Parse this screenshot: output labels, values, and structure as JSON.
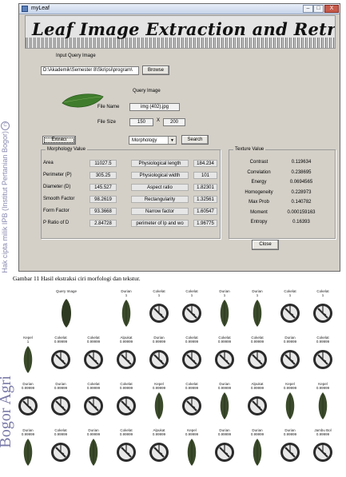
{
  "watermark": {
    "copyright_text": "Hak cipta milik IPB (Institut Pertanian Bogor)",
    "brand_text": "Bogor Agri",
    "copyright_symbol": "C"
  },
  "window": {
    "title": "myLeaf",
    "controls": {
      "minimize": "–",
      "maximize": "□",
      "close": "X"
    }
  },
  "app": {
    "banner_title": "Leaf Image Extraction and Retrieval",
    "input_label": "Input Query Image",
    "path_value": "D:\\Akademik\\Semester 8\\Skripsi\\program\\",
    "browse_label": "Browse",
    "query_image_label": "Query Image",
    "file_name_label": "File Name",
    "file_name_value": "img (402).jpg",
    "file_size_label": "File Size",
    "file_size_w": "150",
    "file_size_x": "X",
    "file_size_h": "200",
    "extract_label": "Extract",
    "method_value": "Morphology",
    "search_label": "Search",
    "close_label": "Close"
  },
  "morphology": {
    "title": "Morphology Value",
    "left": [
      {
        "label": "Area",
        "value": "11027.5"
      },
      {
        "label": "Perimeter (P)",
        "value": "305.25"
      },
      {
        "label": "Diameter (D)",
        "value": "145.527"
      },
      {
        "label": "Smooth Factor",
        "value": "98.2619"
      },
      {
        "label": "Form Factor",
        "value": "93.3668"
      },
      {
        "label": "P Ratio of D",
        "value": "2.84728"
      }
    ],
    "right": [
      {
        "label": "Physiological length",
        "value": "184.234"
      },
      {
        "label": "Physiological width",
        "value": "101"
      },
      {
        "label": "Aspect ratio",
        "value": "1.82301"
      },
      {
        "label": "Rectangularity",
        "value": "1.32561"
      },
      {
        "label": "Narrow factor",
        "value": "1.60547"
      },
      {
        "label": "perimeter of lp and wo",
        "value": "1.96775"
      }
    ]
  },
  "texture": {
    "title": "Texture Value",
    "rows": [
      {
        "label": "Contrast",
        "value": "0.119634"
      },
      {
        "label": "Correlation",
        "value": "0.238695"
      },
      {
        "label": "Energy",
        "value": "0.0694565"
      },
      {
        "label": "Homogeneity",
        "value": "0.228973"
      },
      {
        "label": "Max Prob",
        "value": "0.140782"
      },
      {
        "label": "Moment",
        "value": "0.000159163"
      },
      {
        "label": "Entropy",
        "value": "0.16393"
      }
    ]
  },
  "caption": "Gambar    11 Hasil ekstraksi ciri morfologi dan tekstur.",
  "results": {
    "query_label": "Query Image",
    "rows": [
      [
        {
          "name": "Durian",
          "score": "1",
          "img": "leaf"
        },
        {
          "name": "Cokelat",
          "score": "1",
          "img": "clock"
        },
        {
          "name": "Cokelat",
          "score": "1",
          "img": "clock"
        },
        {
          "name": "Durian",
          "score": "1",
          "img": "leaf"
        },
        {
          "name": "Durian",
          "score": "1",
          "img": "leaf"
        },
        {
          "name": "Cokelat",
          "score": "1",
          "img": "clock"
        },
        {
          "name": "Cokelat",
          "score": "1",
          "img": "clock"
        }
      ],
      [
        {
          "name": "Kepel",
          "score": "1",
          "img": "leaf"
        },
        {
          "name": "Cokelat",
          "score": "0.99999",
          "img": "clock"
        },
        {
          "name": "Cokelat",
          "score": "0.99999",
          "img": "clock"
        },
        {
          "name": "Alpukat",
          "score": "0.99999",
          "img": "clock"
        },
        {
          "name": "Durian",
          "score": "0.99999",
          "img": "clock"
        },
        {
          "name": "Cokelat",
          "score": "0.99999",
          "img": "clock"
        },
        {
          "name": "Cokelat",
          "score": "0.99999",
          "img": "clock"
        },
        {
          "name": "Cokelat",
          "score": "0.99999",
          "img": "clock"
        },
        {
          "name": "Durian",
          "score": "0.99999",
          "img": "clock"
        },
        {
          "name": "Cokelat",
          "score": "0.99999",
          "img": "clock"
        }
      ],
      [
        {
          "name": "Durian",
          "score": "0.99999",
          "img": "clock"
        },
        {
          "name": "Durian",
          "score": "0.99999",
          "img": "clock"
        },
        {
          "name": "Cokelat",
          "score": "0.99999",
          "img": "clock"
        },
        {
          "name": "Cokelat",
          "score": "0.99999",
          "img": "clock"
        },
        {
          "name": "Kepel",
          "score": "0.99999",
          "img": "leaf"
        },
        {
          "name": "Cokelat",
          "score": "0.99999",
          "img": "clock"
        },
        {
          "name": "Durian",
          "score": "0.99999",
          "img": "leaf"
        },
        {
          "name": "Alpukat",
          "score": "0.99999",
          "img": "clock"
        },
        {
          "name": "Kepel",
          "score": "0.99999",
          "img": "leaf"
        },
        {
          "name": "Kepel",
          "score": "0.99999",
          "img": "leaf"
        }
      ],
      [
        {
          "name": "Durian",
          "score": "0.99999",
          "img": "leaf"
        },
        {
          "name": "Cokelat",
          "score": "0.99999",
          "img": "clock"
        },
        {
          "name": "Durian",
          "score": "0.99999",
          "img": "leaf"
        },
        {
          "name": "Cokelat",
          "score": "0.99999",
          "img": "clock"
        },
        {
          "name": "Alpukat",
          "score": "0.99999",
          "img": "clock"
        },
        {
          "name": "Kepel",
          "score": "0.99999",
          "img": "leaf"
        },
        {
          "name": "Durian",
          "score": "0.99999",
          "img": "clock"
        },
        {
          "name": "Durian",
          "score": "0.99999",
          "img": "leaf"
        },
        {
          "name": "Durian",
          "score": "0.99999",
          "img": "clock"
        },
        {
          "name": "Jambu Bol",
          "score": "0.99999",
          "img": "clock"
        }
      ]
    ]
  }
}
